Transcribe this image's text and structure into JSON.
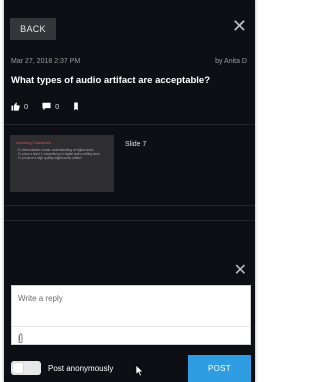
{
  "header": {
    "back_label": "BACK",
    "close_icon": "close-icon"
  },
  "post": {
    "date": "Mar 27, 2018 2:37 PM",
    "author": "by Anita D",
    "title": "What types of audio artifact are acceptable?",
    "likes": "0",
    "comments": "0",
    "icons": [
      "thumbs-up-icon",
      "comment-icon",
      "bookmark-icon"
    ]
  },
  "slide": {
    "label": "Slide 7",
    "thumb_title": "Learning Outcomes",
    "thumb_lines": [
      "- To demonstrate a basic understanding of digital audio",
      "- To show a level 1 competency in digital audio editing tools",
      "- To produce a high quality digital audio artifact"
    ]
  },
  "reply": {
    "placeholder": "Write a reply",
    "close_icon": "close-icon",
    "attach_icon": "paperclip-icon",
    "anonymous_label": "Post anonymously",
    "anonymous_on": false,
    "post_label": "POST"
  },
  "colors": {
    "panel_bg": "#0d0f14",
    "accent": "#2f9de2",
    "back_button_bg": "#34363a"
  }
}
